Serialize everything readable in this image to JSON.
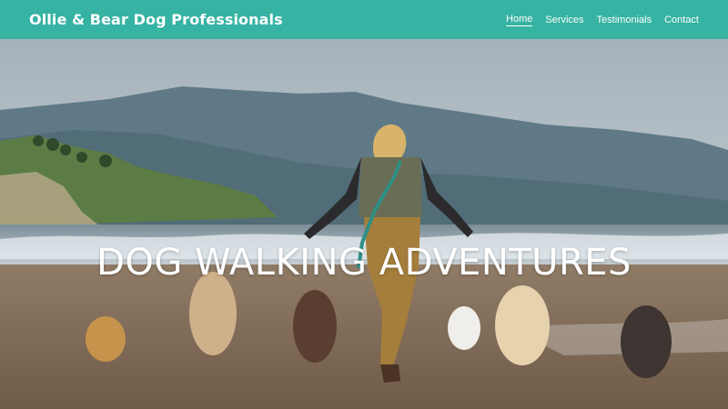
{
  "header": {
    "brand": "Ollie & Bear Dog Professionals",
    "nav": [
      {
        "label": "Home",
        "active": true
      },
      {
        "label": "Services",
        "active": false
      },
      {
        "label": "Testimonials",
        "active": false
      },
      {
        "label": "Contact",
        "active": false
      }
    ]
  },
  "hero": {
    "title": "DOG WALKING ADVENTURES",
    "image": "beach-dog-walk-photo"
  },
  "colors": {
    "header_bg": "#36b3a2",
    "nav_text": "#ffffff",
    "hero_title": "#ffffff"
  }
}
